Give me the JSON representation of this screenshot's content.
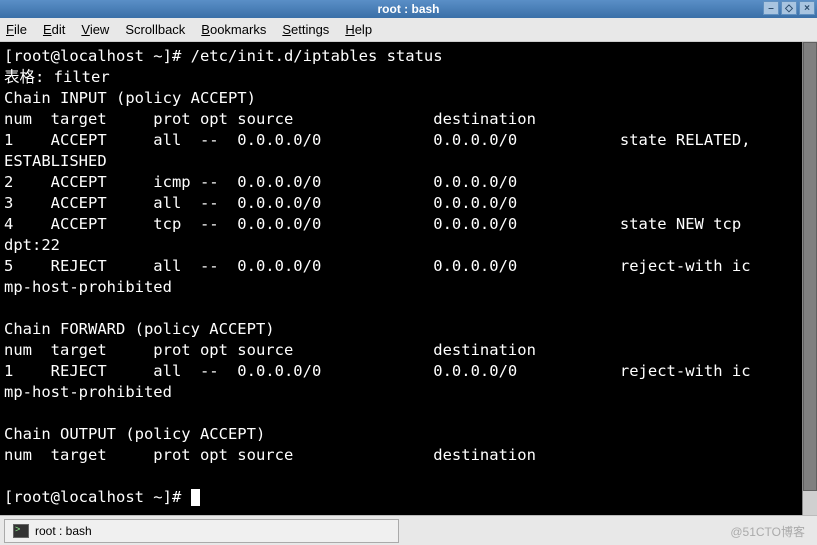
{
  "window": {
    "title": "root : bash"
  },
  "menu": {
    "file": "File",
    "edit": "Edit",
    "view": "View",
    "scrollback": "Scrollback",
    "bookmarks": "Bookmarks",
    "settings": "Settings",
    "help": "Help"
  },
  "terminal": {
    "lines": [
      "[root@localhost ~]# /etc/init.d/iptables status",
      "表格: filter",
      "Chain INPUT (policy ACCEPT)",
      "num  target     prot opt source               destination",
      "1    ACCEPT     all  --  0.0.0.0/0            0.0.0.0/0           state RELATED,",
      "ESTABLISHED",
      "2    ACCEPT     icmp --  0.0.0.0/0            0.0.0.0/0",
      "3    ACCEPT     all  --  0.0.0.0/0            0.0.0.0/0",
      "4    ACCEPT     tcp  --  0.0.0.0/0            0.0.0.0/0           state NEW tcp ",
      "dpt:22",
      "5    REJECT     all  --  0.0.0.0/0            0.0.0.0/0           reject-with ic",
      "mp-host-prohibited",
      "",
      "Chain FORWARD (policy ACCEPT)",
      "num  target     prot opt source               destination",
      "1    REJECT     all  --  0.0.0.0/0            0.0.0.0/0           reject-with ic",
      "mp-host-prohibited",
      "",
      "Chain OUTPUT (policy ACCEPT)",
      "num  target     prot opt source               destination",
      ""
    ],
    "prompt": "[root@localhost ~]# "
  },
  "taskbar": {
    "item_label": "root : bash"
  },
  "watermark": "@51CTO博客"
}
